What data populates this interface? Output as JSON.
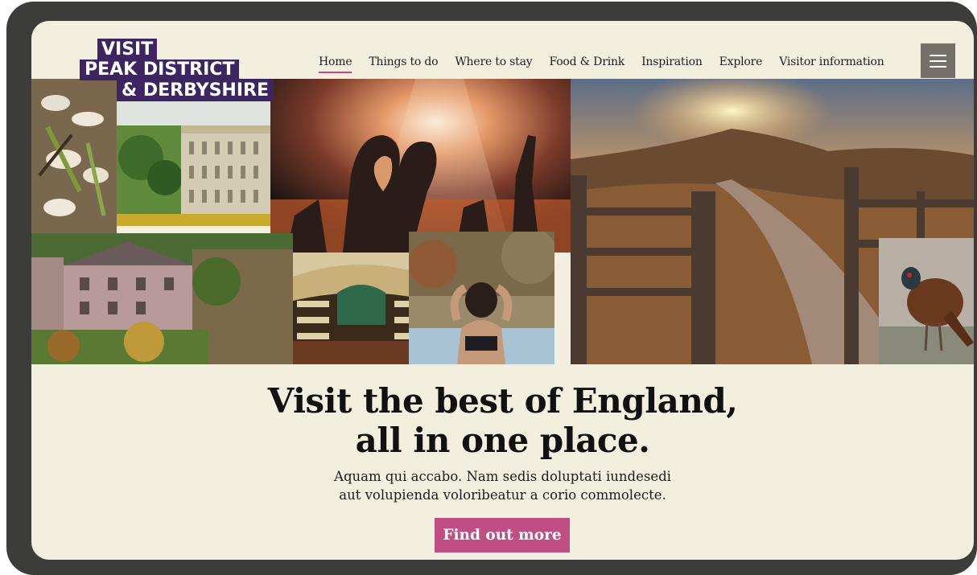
{
  "logo": {
    "line1": "VISIT",
    "line2": "PEAK DISTRICT",
    "line3": "& DERBYSHIRE",
    "color": "#3d2561"
  },
  "nav": {
    "items": [
      {
        "label": "Home",
        "active": true
      },
      {
        "label": "Things to do"
      },
      {
        "label": "Where to stay"
      },
      {
        "label": "Food & Drink"
      },
      {
        "label": "Inspiration"
      },
      {
        "label": "Explore"
      },
      {
        "label": "Visitor information"
      }
    ],
    "menu_icon": "hamburger-menu-icon"
  },
  "collage": {
    "images": [
      "food-dish",
      "stately-home",
      "concert-crowd",
      "sunrise-hills-gate",
      "stone-cottages",
      "theatre-auditorium",
      "hot-spring-bather",
      "pheasant"
    ]
  },
  "hero": {
    "headline_line1": "Visit the best of England,",
    "headline_line2": "all in one place.",
    "body_line1": "Aquam qui accabo. Nam sedis doluptati iundesedi",
    "body_line2": "aut volupienda voloribeatur a corio commolecte.",
    "cta_label": "Find out more"
  },
  "colors": {
    "accent": "#c14e83",
    "background": "#f2efdf",
    "frame": "#3c3c3a"
  }
}
